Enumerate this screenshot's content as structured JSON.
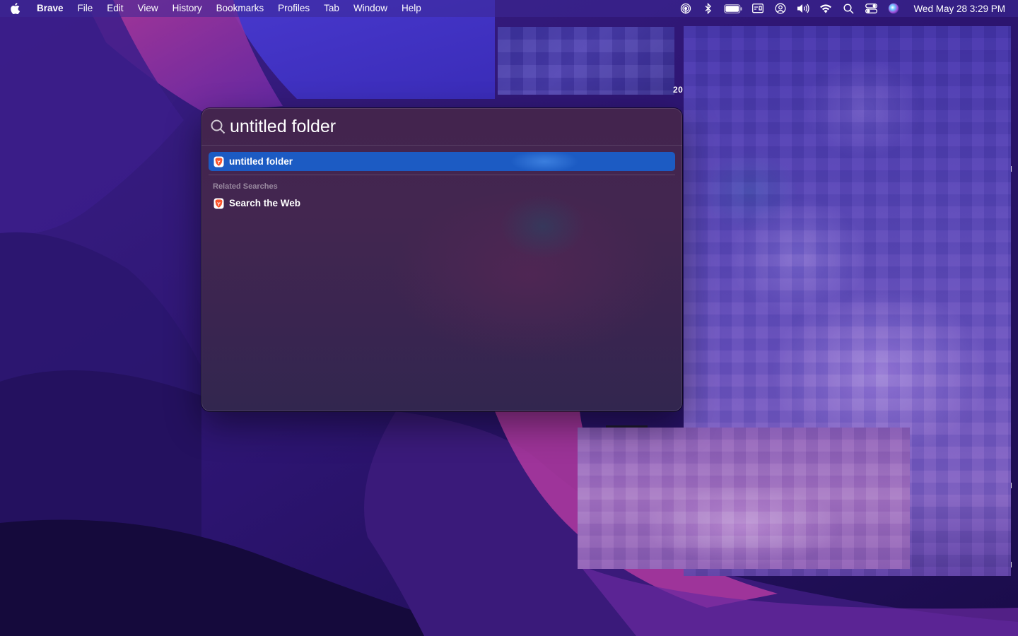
{
  "menubar": {
    "app_name": "Brave",
    "items": [
      "File",
      "Edit",
      "View",
      "History",
      "Bookmarks",
      "Profiles",
      "Tab",
      "Window",
      "Help"
    ],
    "status_icons": [
      "airdrop-icon",
      "bluetooth-icon",
      "battery-icon",
      "screen-mirroring-icon",
      "user-account-icon",
      "volume-icon",
      "wifi-icon",
      "spotlight-search-icon",
      "control-center-icon",
      "siri-icon"
    ],
    "clock": "Wed May 28  3:29 PM"
  },
  "spotlight": {
    "query": "untitled folder",
    "top_hit": {
      "label": "untitled folder",
      "icon": "brave-icon"
    },
    "section_header": "Related Searches",
    "related": [
      {
        "label": "Search the Web",
        "icon": "brave-icon"
      }
    ]
  },
  "background": {
    "partial_label": "20"
  },
  "colors": {
    "selection": "#1c5bc3",
    "brave_brand": "#fb542b"
  }
}
